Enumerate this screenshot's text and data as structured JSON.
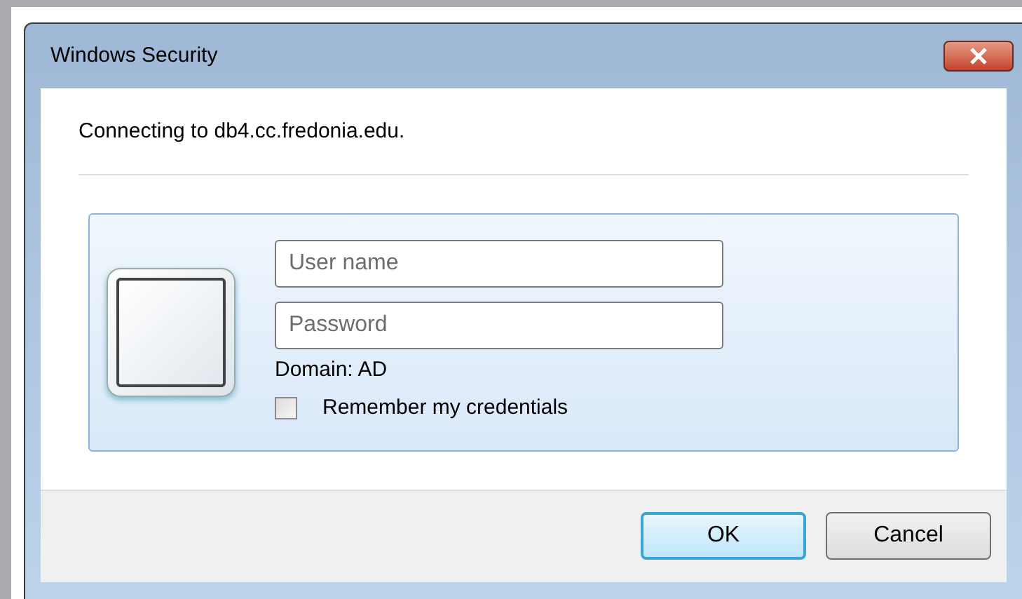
{
  "window": {
    "title": "Windows Security"
  },
  "message": "Connecting to db4.cc.fredonia.edu.",
  "fields": [
    {
      "placeholder": "User name"
    },
    {
      "placeholder": "Password"
    }
  ],
  "domain": "Domain: AD",
  "remember": {
    "label": "Remember my credentials",
    "checked": false
  },
  "buttons": [
    {
      "label": "OK",
      "default": true
    },
    {
      "label": "Cancel",
      "default": false
    }
  ]
}
